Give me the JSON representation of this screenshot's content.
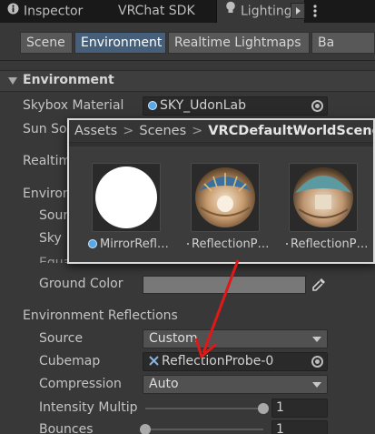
{
  "window_tabs": [
    {
      "label": "Inspector"
    },
    {
      "label": "VRChat SDK"
    },
    {
      "label": "Lighting"
    }
  ],
  "sub_tabs": [
    {
      "label": "Scene"
    },
    {
      "label": "Environment"
    },
    {
      "label": "Realtime Lightmaps"
    },
    {
      "label": "Ba"
    }
  ],
  "section_title": "Environment",
  "rows": {
    "skybox_material_label": "Skybox Material",
    "skybox_material_value": "SKY_UdonLab",
    "sun_source_label": "Sun So",
    "realtime_label": "Realtim",
    "environment_label": "Enviror",
    "source_label_partial": "Sour",
    "sky_label_partial": "Sky",
    "equator_color_label": "Equator Color",
    "ground_color_label": "Ground Color",
    "env_reflections_label": "Environment Reflections",
    "source_label": "Source",
    "source_value": "Custom",
    "cubemap_label": "Cubemap",
    "cubemap_value": "ReflectionProbe-0",
    "compression_label": "Compression",
    "compression_value": "Auto",
    "intensity_label": "Intensity Multip",
    "intensity_value": "1",
    "bounces_label": "Bounces",
    "bounces_value": "1"
  },
  "popup": {
    "breadcrumb": [
      "Assets",
      "Scenes",
      "VRCDefaultWorldScene"
    ],
    "items": [
      {
        "label": "MirrorRefl…",
        "icon": "mirror-white-sphere-icon"
      },
      {
        "label": "ReflectionP…",
        "icon": "reflection-probe-sphere-icon"
      },
      {
        "label": "ReflectionP…",
        "icon": "reflection-probe-sphere-icon"
      }
    ]
  },
  "colors": {
    "accent_tab": "#46607c",
    "annotation_arrow": "#e01818",
    "background": "#383838"
  },
  "slider_levels": {
    "intensity": 1.0,
    "bounces": 0.0
  }
}
